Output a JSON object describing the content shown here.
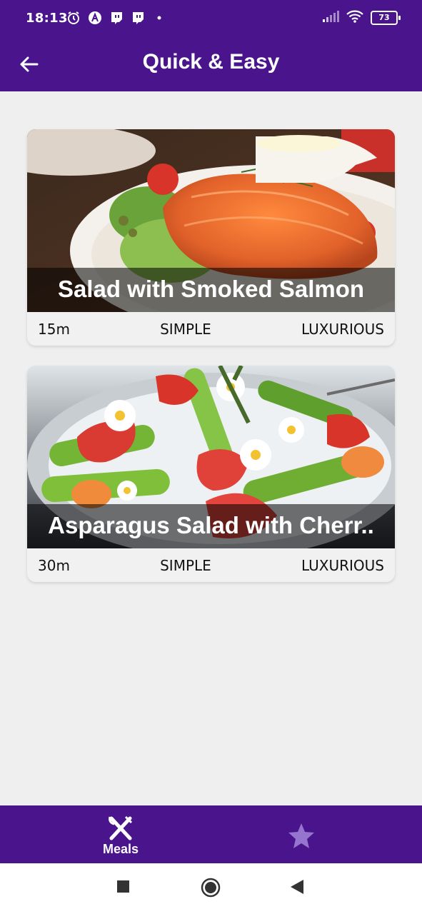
{
  "status_bar": {
    "time": "18:13",
    "battery": "73",
    "icons": [
      "alarm-icon",
      "a-icon",
      "twitch-icon",
      "twitch-icon",
      "dot-icon"
    ],
    "right_icons": [
      "signal-icon",
      "wifi-icon",
      "battery-icon"
    ]
  },
  "app_bar": {
    "title": "Quick & Easy",
    "back_icon": "arrow-left-icon"
  },
  "meals": [
    {
      "title": "Salad with Smoked Salmon",
      "duration": "15m",
      "complexity": "SIMPLE",
      "affordability": "LUXURIOUS"
    },
    {
      "title": "Asparagus Salad with Cherr..",
      "duration": "30m",
      "complexity": "SIMPLE",
      "affordability": "LUXURIOUS"
    }
  ],
  "bottom_nav": {
    "items": [
      {
        "label": "Meals",
        "icon": "fork-knife-icon",
        "active": true
      },
      {
        "label": "",
        "icon": "star-icon",
        "active": false
      }
    ]
  },
  "colors": {
    "primary": "#4a148c",
    "background": "#efefef",
    "inactive_nav": "#9575cd"
  }
}
